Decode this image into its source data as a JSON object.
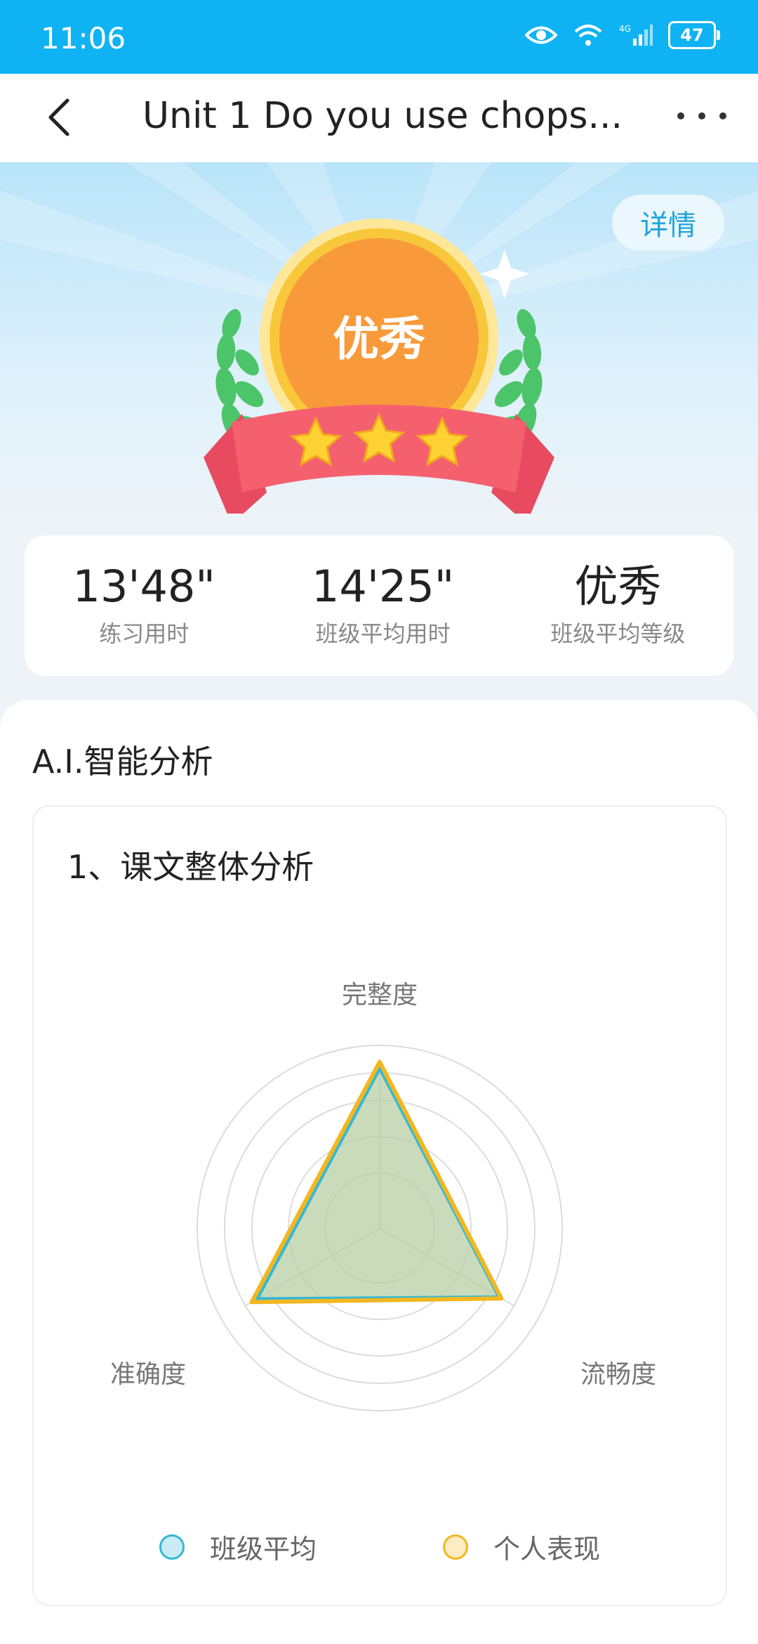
{
  "status_bar": {
    "time": "11:06",
    "battery": "47"
  },
  "nav": {
    "title": "Unit 1 Do you use chops..."
  },
  "hero": {
    "detail_label": "详情",
    "grade": "优秀",
    "stars": 3
  },
  "stats": [
    {
      "value": "13'48\"",
      "label": "练习用时"
    },
    {
      "value": "14'25\"",
      "label": "班级平均用时"
    },
    {
      "value": "优秀",
      "label": "班级平均等级"
    }
  ],
  "analysis": {
    "title": "A.I.智能分析",
    "section": "1、课文整体分析"
  },
  "chart_data": {
    "type": "radar",
    "axes": [
      "完整度",
      "流畅度",
      "准确度"
    ],
    "max": 100,
    "series": [
      {
        "name": "班级平均",
        "color": "#33b8d6",
        "values": [
          88,
          76,
          78
        ]
      },
      {
        "name": "个人表现",
        "color": "#f2b721",
        "values": [
          91,
          77,
          81
        ]
      }
    ],
    "fill_color": "#b8cfa6"
  }
}
